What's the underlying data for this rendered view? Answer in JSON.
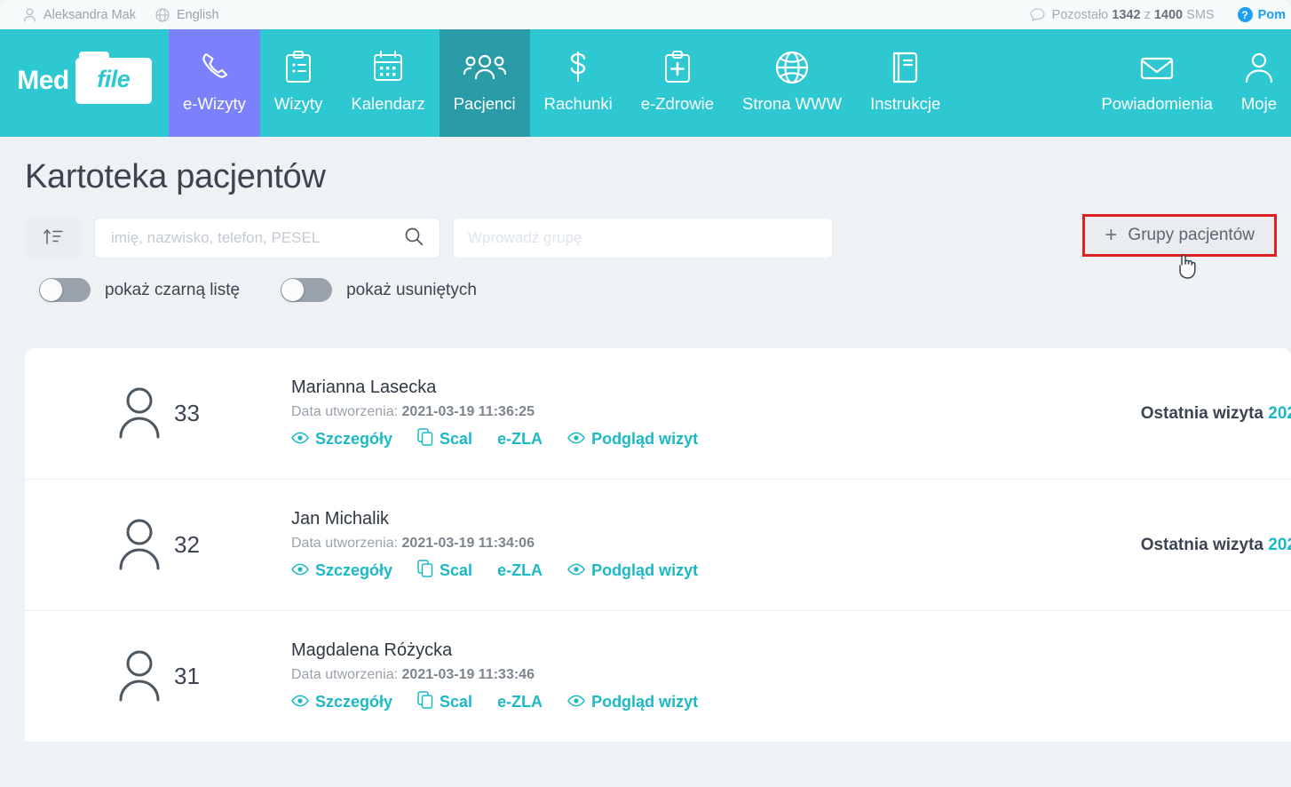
{
  "topbar": {
    "user_icon": "user-icon",
    "user_name": "Aleksandra Mak",
    "language_icon": "globe-icon",
    "language": "English",
    "sms_icon": "chat-bubble-icon",
    "sms_prefix": "Pozostało",
    "sms_remaining": "1342",
    "sms_middle": "z",
    "sms_total": "1400",
    "sms_suffix": "SMS",
    "help_icon": "question-circle-icon",
    "help_label": "Pom"
  },
  "brand": {
    "name_left": "Med",
    "name_right": "file"
  },
  "nav": {
    "items": [
      {
        "label": "e-Wizyty",
        "icon": "phone-handset-icon",
        "state": "purple"
      },
      {
        "label": "Wizyty",
        "icon": "clipboard-list-icon",
        "state": "default"
      },
      {
        "label": "Kalendarz",
        "icon": "calendar-icon",
        "state": "default"
      },
      {
        "label": "Pacjenci",
        "icon": "people-group-icon",
        "state": "active"
      },
      {
        "label": "Rachunki",
        "icon": "dollar-icon",
        "state": "default"
      },
      {
        "label": "e-Zdrowie",
        "icon": "clipboard-medical-icon",
        "state": "default"
      },
      {
        "label": "Strona WWW",
        "icon": "globe-icon",
        "state": "default"
      },
      {
        "label": "Instrukcje",
        "icon": "book-icon",
        "state": "default"
      }
    ],
    "right_items": [
      {
        "label": "Powiadomienia",
        "icon": "envelope-icon",
        "state": "default"
      },
      {
        "label": "Moje",
        "icon": "user-icon",
        "state": "default"
      }
    ]
  },
  "page": {
    "title": "Kartoteka pacjentów",
    "sort_icon": "sort-ascending-icon",
    "search": {
      "placeholder": "imię, nazwisko, telefon, PESEL",
      "value": "",
      "icon": "search-icon"
    },
    "group": {
      "placeholder": "Wprowadź grupę",
      "value": ""
    },
    "groups_button": {
      "plus": "+",
      "label": "Grupy pacjentów",
      "highlight_color": "#e02020"
    },
    "toggles": [
      {
        "label": "pokaż czarną listę",
        "checked": false
      },
      {
        "label": "pokaż usuniętych",
        "checked": false
      }
    ]
  },
  "list": {
    "date_label": "Data utworzenia:",
    "last_visit_label": "Ostatnia wizyta",
    "actions": [
      {
        "label": "Szczegóły",
        "icon": "eye-icon"
      },
      {
        "label": "Scal",
        "icon": "copy-icon"
      },
      {
        "label": "e-ZLA",
        "icon": "none"
      },
      {
        "label": "Podgląd wizyt",
        "icon": "eye-icon"
      }
    ],
    "patients": [
      {
        "id": "33",
        "name": "Marianna Lasecka",
        "created": "2021-03-19 11:36:25",
        "last_visit": "202"
      },
      {
        "id": "32",
        "name": "Jan Michalik",
        "created": "2021-03-19 11:34:06",
        "last_visit": "202"
      },
      {
        "id": "31",
        "name": "Magdalena Różycka",
        "created": "2021-03-19 11:33:46",
        "last_visit": ""
      }
    ]
  },
  "colors": {
    "teal": "#2ec8d3",
    "teal_active": "#2a9ca8",
    "purple": "#7b80fb",
    "link_teal": "#1bb8c6",
    "help_blue": "#1e9ff2",
    "highlight_red": "#e02020"
  }
}
